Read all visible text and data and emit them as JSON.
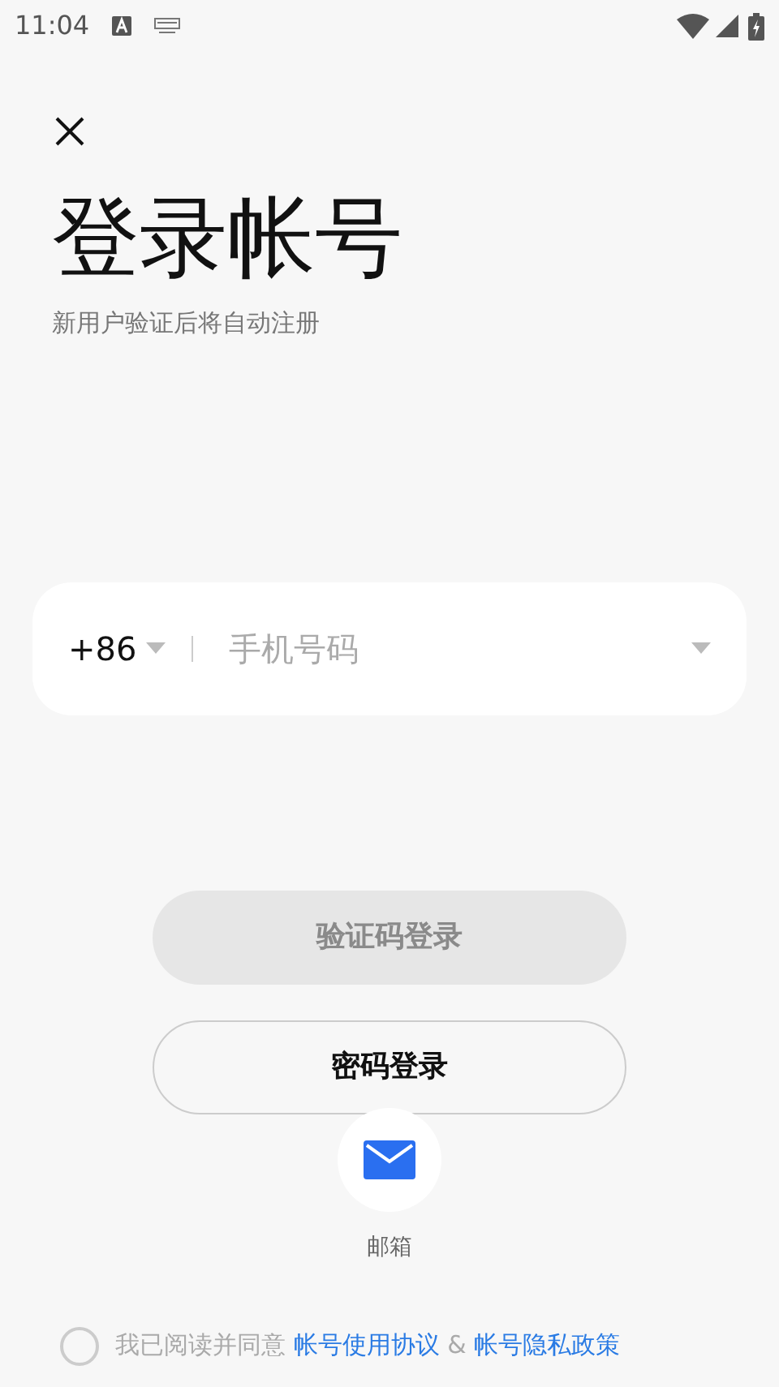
{
  "status_bar": {
    "time": "11:04"
  },
  "title": "登录帐号",
  "subtitle": "新用户验证后将自动注册",
  "phone": {
    "country_code": "+86",
    "placeholder": "手机号码"
  },
  "buttons": [
    {
      "label": "验证码登录",
      "kind": "filled",
      "disabled": true
    },
    {
      "label": "密码登录",
      "kind": "outline",
      "disabled": false
    }
  ],
  "alt_login": {
    "label": "邮箱"
  },
  "agreement": {
    "checked": false,
    "text": "我已阅读并同意",
    "link_1": "帐号使用协议",
    "separator": "&",
    "link_2": "帐号隐私政策"
  }
}
